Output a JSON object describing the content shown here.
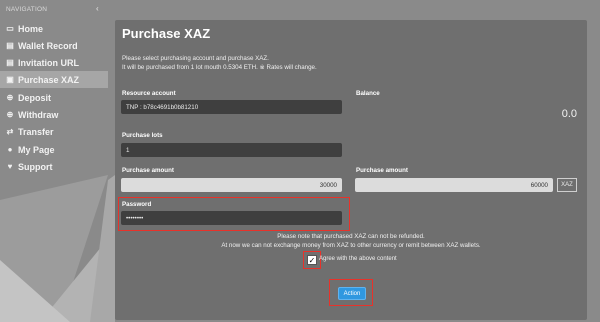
{
  "sidebar": {
    "header": "NAVIGATION",
    "collapse_icon": "chevron-left-icon",
    "items": [
      {
        "label": "Home",
        "icon": "monitor-icon",
        "active": false
      },
      {
        "label": "Wallet Record",
        "icon": "document-icon",
        "active": false
      },
      {
        "label": "Invitation URL",
        "icon": "document-icon",
        "active": false
      },
      {
        "label": "Purchase XAZ",
        "icon": "money-icon",
        "active": true
      },
      {
        "label": "Deposit",
        "icon": "circle-arrow-icon",
        "active": false
      },
      {
        "label": "Withdraw",
        "icon": "circle-arrow-icon",
        "active": false
      },
      {
        "label": "Transfer",
        "icon": "transfer-icon",
        "active": false
      },
      {
        "label": "My Page",
        "icon": "user-icon",
        "active": false
      },
      {
        "label": "Support",
        "icon": "heart-icon",
        "active": false
      }
    ]
  },
  "panel": {
    "title": "Purchase XAZ",
    "desc1": "Please select purchasing account and purchase XAZ.",
    "desc2": "It will be purchased from 1 lot mouth 0.5304 ETH. ※ Rates will change.",
    "resource_account_label": "Resource account",
    "resource_account_value": "TNP : b78c4691b0b81210",
    "balance_label": "Balance",
    "balance_value": "0.0",
    "purchase_lots_label": "Purchase lots",
    "purchase_lots_value": "1",
    "purchase_amount_label": "Purchase amount",
    "purchase_amount_value": "30000",
    "purchase_amount2_label": "Purchase amount",
    "purchase_amount2_value": "60000",
    "unit": "XAZ",
    "password_label": "Password",
    "password_value": "••••••••",
    "note1": "Please note that purchased XAZ can not be refunded.",
    "note2": "At now we can not exchange money from XAZ to other currency or remit between XAZ wallets.",
    "agree_text": "Agree with the above content",
    "agree_checked": true,
    "action_label": "Action"
  },
  "colors": {
    "highlight": "#e8322a",
    "action_button": "#2f98e0"
  }
}
